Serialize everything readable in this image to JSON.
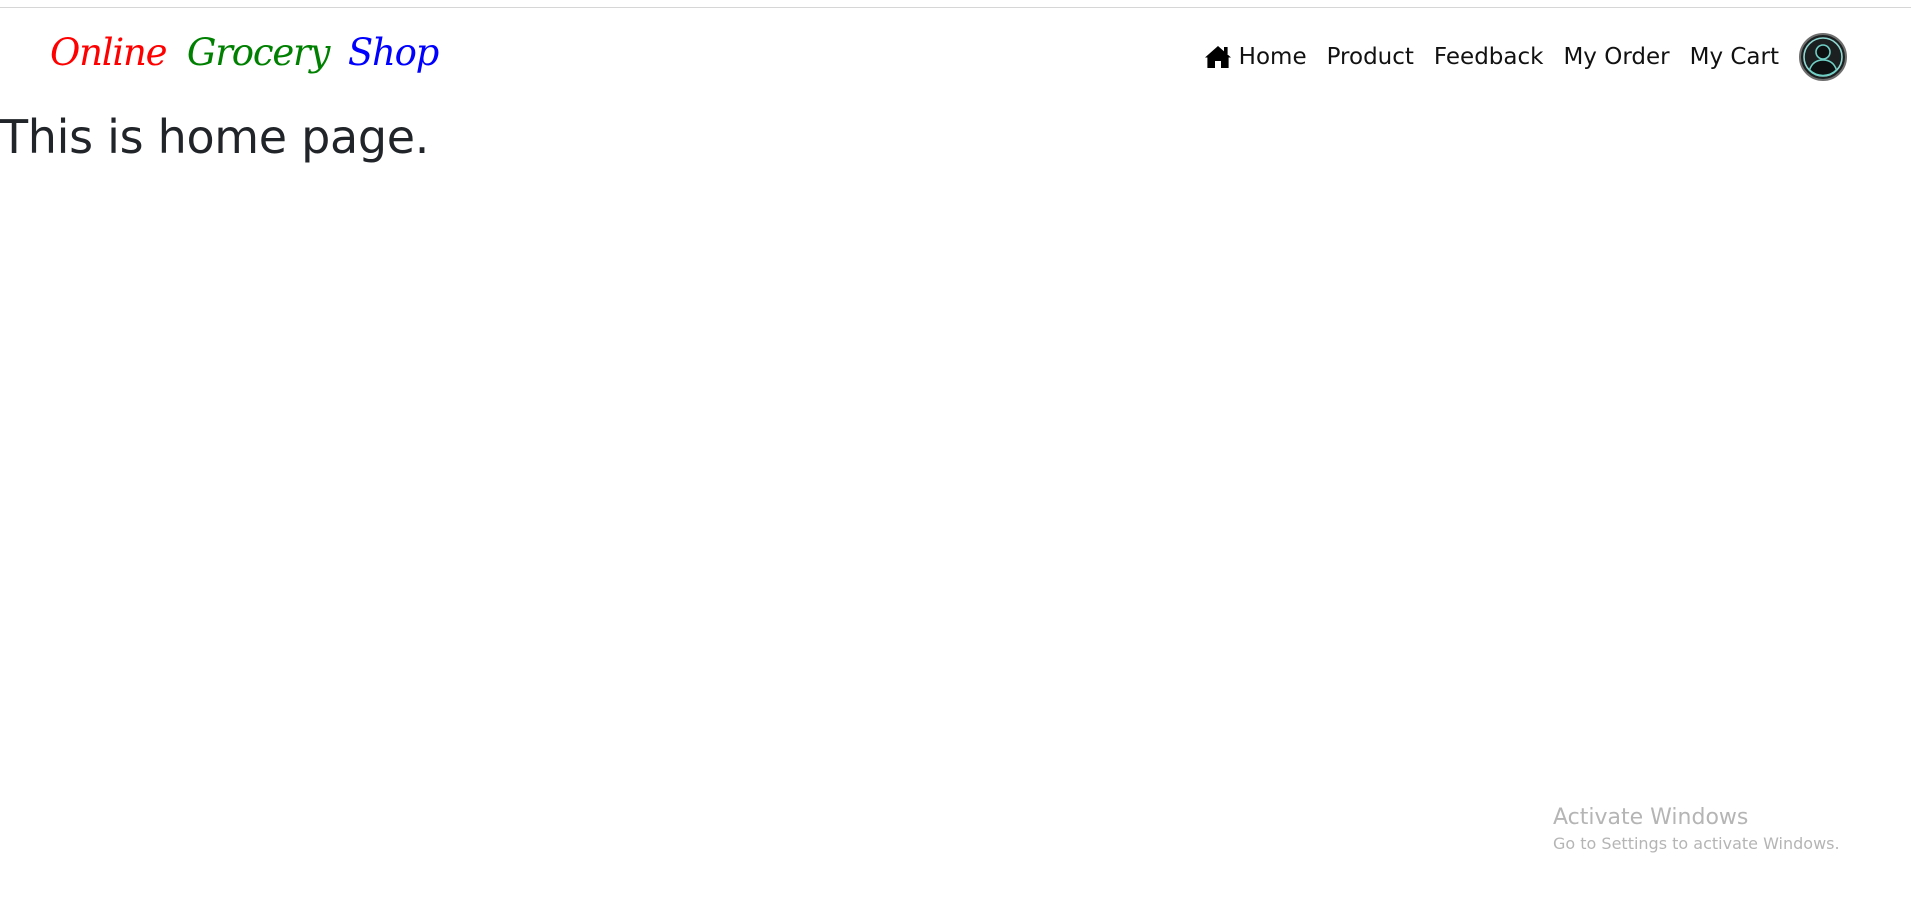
{
  "brand": {
    "word1": "Online",
    "word2": "Grocery",
    "word3": "Shop",
    "colors": [
      "#ff0000",
      "#008000",
      "#0000ff"
    ]
  },
  "nav": {
    "home_icon": "home-icon",
    "home": "Home",
    "product": "Product",
    "feedback": "Feedback",
    "my_order": "My Order",
    "my_cart": "My Cart",
    "avatar_icon": "user-avatar-icon"
  },
  "main": {
    "title": "This is home page."
  },
  "watermark": {
    "title": "Activate Windows",
    "subtitle": "Go to Settings to activate Windows."
  }
}
